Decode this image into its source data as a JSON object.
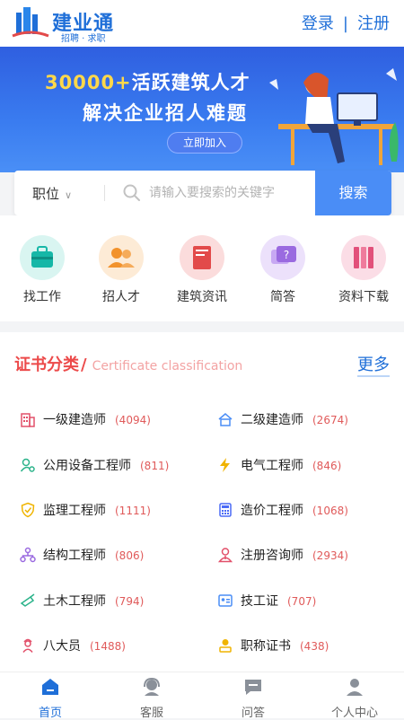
{
  "header": {
    "logo_name": "建业通",
    "logo_sub": "招聘 · 求职",
    "login": "登录",
    "separator": "|",
    "register": "注册"
  },
  "banner": {
    "number": "30000+",
    "headline_rest": "活跃建筑人才",
    "subline": "解决企业招人难题",
    "cta": "立即加入"
  },
  "search": {
    "type_value": "职位",
    "placeholder": "请输入要搜索的关键字",
    "button": "搜索"
  },
  "quicknav": [
    {
      "label": "找工作",
      "icon": "briefcase-icon",
      "color": "#16b7a7"
    },
    {
      "label": "招人才",
      "icon": "people-icon",
      "color": "#f2922c"
    },
    {
      "label": "建筑资讯",
      "icon": "book-icon",
      "color": "#e24a4a"
    },
    {
      "label": "简答",
      "icon": "question-chat-icon",
      "color": "#9a6ae0"
    },
    {
      "label": "资料下载",
      "icon": "books-icon",
      "color": "#e2507a"
    }
  ],
  "certificates": {
    "title": "证书分类",
    "slash": "/",
    "subtitle_en": "Certificate classification",
    "more": "更多",
    "items": [
      {
        "name": "一级建造师",
        "count": "(4094)",
        "icon": "building-icon",
        "color": "#e2506a"
      },
      {
        "name": "二级建造师",
        "count": "(2674)",
        "icon": "house-icon",
        "color": "#4a8df6"
      },
      {
        "name": "公用设备工程师",
        "count": "(811)",
        "icon": "gear-user-icon",
        "color": "#2bb38a"
      },
      {
        "name": "电气工程师",
        "count": "(846)",
        "icon": "lightning-icon",
        "color": "#f0b400"
      },
      {
        "name": "监理工程师",
        "count": "(1111)",
        "icon": "shield-check-icon",
        "color": "#f0b400"
      },
      {
        "name": "造价工程师",
        "count": "(1068)",
        "icon": "calculator-icon",
        "color": "#4a6af6"
      },
      {
        "name": "结构工程师",
        "count": "(806)",
        "icon": "structure-icon",
        "color": "#9a6ae0"
      },
      {
        "name": "注册咨询师",
        "count": "(2934)",
        "icon": "consultant-icon",
        "color": "#e2506a"
      },
      {
        "name": "土木工程师",
        "count": "(794)",
        "icon": "trowel-icon",
        "color": "#2bb38a"
      },
      {
        "name": "技工证",
        "count": "(707)",
        "icon": "id-card-icon",
        "color": "#4a8df6"
      },
      {
        "name": "八大员",
        "count": "(1488)",
        "icon": "worker-icon",
        "color": "#e2506a"
      },
      {
        "name": "职称证书",
        "count": "(438)",
        "icon": "certificate-person-icon",
        "color": "#f0b400"
      }
    ]
  },
  "bottomnav": [
    {
      "label": "首页",
      "icon": "home-icon",
      "active": true
    },
    {
      "label": "客服",
      "icon": "headset-icon",
      "active": false
    },
    {
      "label": "问答",
      "icon": "chat-icon",
      "active": false
    },
    {
      "label": "个人中心",
      "icon": "user-icon",
      "active": false
    }
  ],
  "colors": {
    "brand": "#1f6fd8",
    "search_button": "#4a8df6",
    "section_title": "#ec4a4a",
    "count": "#e05a5a"
  }
}
